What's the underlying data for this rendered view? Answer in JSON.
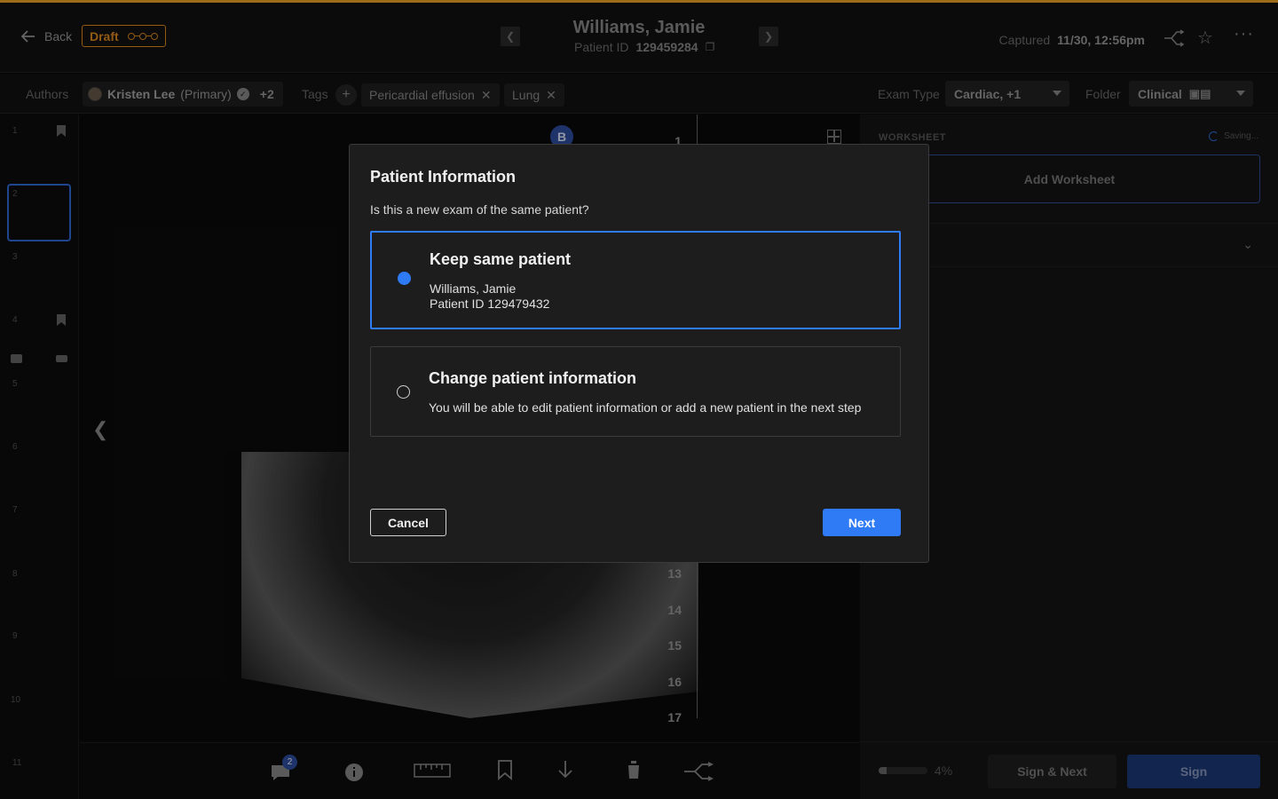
{
  "header": {
    "back_label": "Back",
    "status_label": "Draft",
    "patient_name": "Williams, Jamie",
    "patient_id_label": "Patient ID",
    "patient_id": "129459284",
    "captured_label": "Captured",
    "captured_value": "11/30, 12:56pm"
  },
  "meta": {
    "authors_label": "Authors",
    "author_name": "Kristen Lee",
    "author_role": "(Primary)",
    "author_more": "+2",
    "tags_label": "Tags",
    "tags": [
      "Pericardial effusion",
      "Lung"
    ],
    "exam_type_label": "Exam Type",
    "exam_type_value": "Cardiac, +1",
    "folder_label": "Folder",
    "folder_value": "Clinical"
  },
  "thumbnails": [
    "1",
    "2",
    "3",
    "4",
    "5",
    "6",
    "7",
    "8",
    "9",
    "10",
    "11"
  ],
  "viewer": {
    "badge": "B",
    "ruler_labels": [
      "1",
      "13",
      "14",
      "15",
      "16",
      "17"
    ]
  },
  "toolbar": {
    "comments_count": "2"
  },
  "worksheet": {
    "label": "WORKSHEET",
    "saving_text": "Saving...",
    "add_label": "Add Worksheet",
    "progress_value": 0.04,
    "progress_text": "4%",
    "sign_next_label": "Sign & Next",
    "sign_label": "Sign"
  },
  "modal": {
    "title": "Patient Information",
    "subtitle": "Is this a new exam of the same patient?",
    "option_keep_title": "Keep same patient",
    "option_keep_name": "Williams, Jamie",
    "option_keep_id": "Patient ID 129479432",
    "option_change_title": "Change patient information",
    "option_change_desc": "You will be able to edit patient information or add a new patient in the next step",
    "cancel_label": "Cancel",
    "next_label": "Next"
  },
  "colors": {
    "accent": "#2f7bf5",
    "draft": "#e08a1e",
    "top_accent": "#f2a626"
  }
}
